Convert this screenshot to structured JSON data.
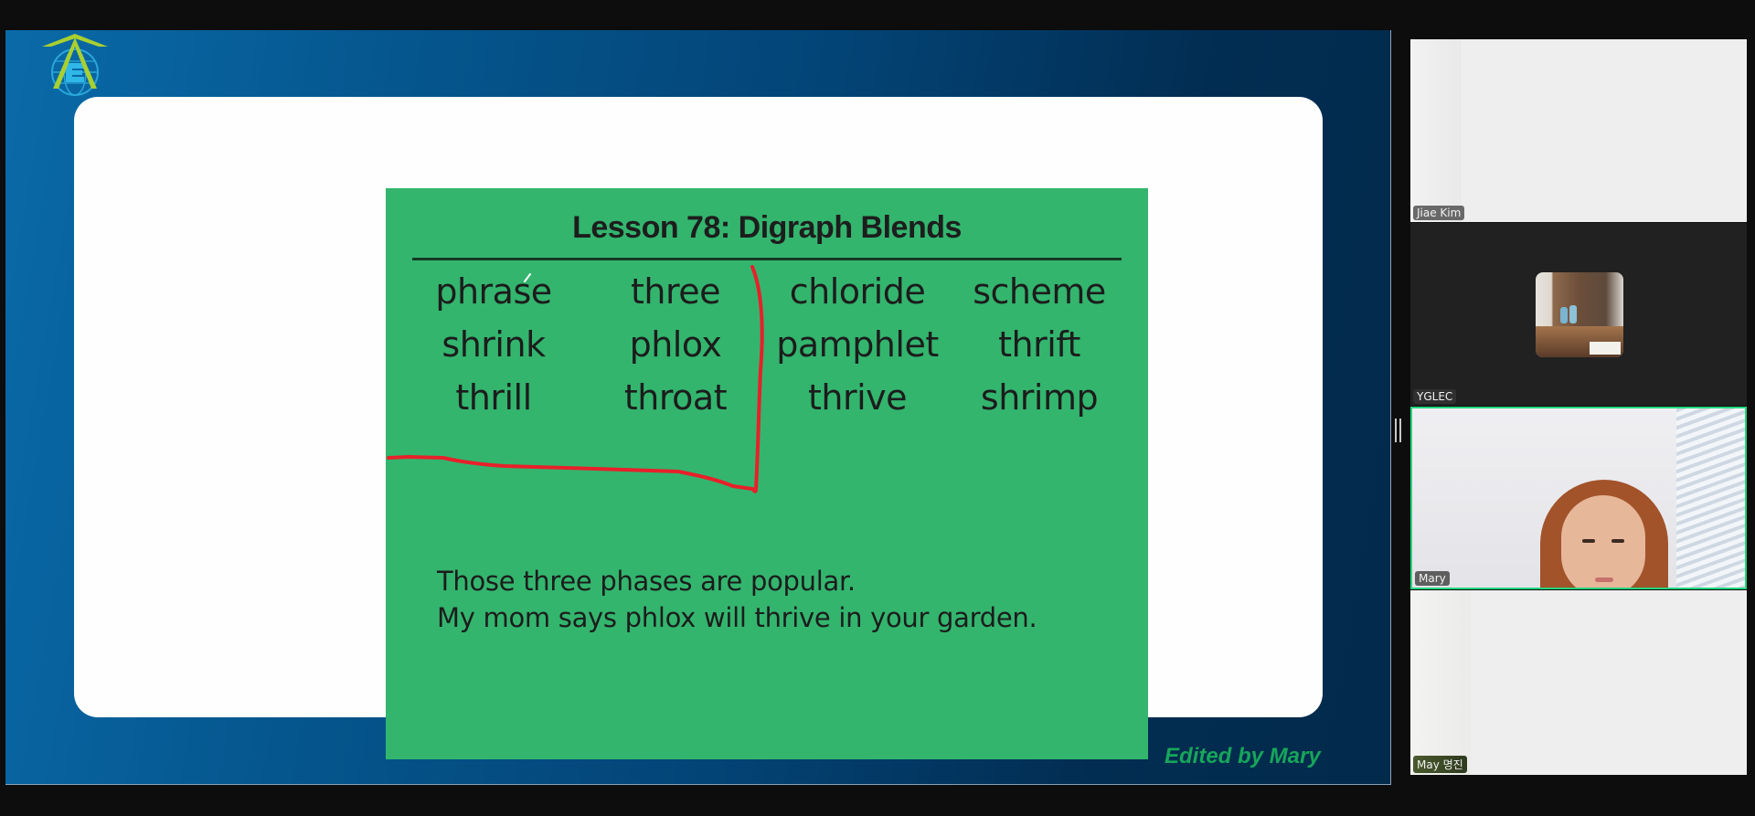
{
  "shared_screen": {
    "logo": "yglec-globe-arrow-logo",
    "slide": {
      "title": "Lesson 78: Digraph Blends",
      "words": [
        [
          "phrase",
          "three",
          "chloride",
          "scheme"
        ],
        [
          "shrink",
          "phlox",
          "pamphlet",
          "thrift"
        ],
        [
          "thrill",
          "throat",
          "thrive",
          "shrimp"
        ]
      ],
      "sentences": [
        "Those three phases are popular.",
        "My mom says phlox will thrive in your garden."
      ],
      "background_color": "#33b56e",
      "annotation_color": "#e8202a"
    },
    "credit": "Edited by Mary"
  },
  "participants": [
    {
      "name": "Jiae Kim",
      "video": "on"
    },
    {
      "name": "YGLEC",
      "video": "off-profile-picture"
    },
    {
      "name": "Mary",
      "video": "on",
      "active_speaker": true,
      "highlight_color": "#23d67f"
    },
    {
      "name": "May 명진",
      "video": "on"
    }
  ]
}
